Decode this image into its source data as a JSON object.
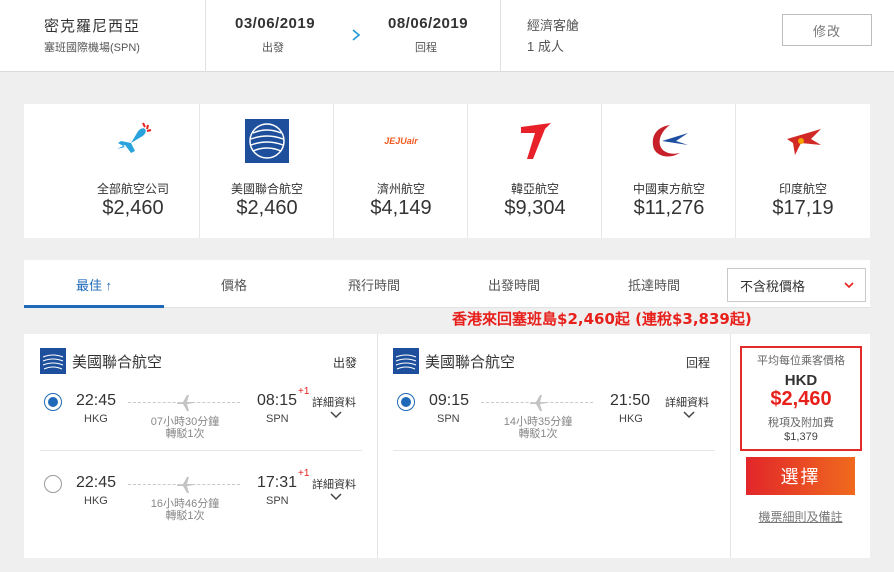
{
  "search": {
    "destination": "密克羅尼西亞",
    "airport": "塞班國際機場(SPN)",
    "depart_date": "03/06/2019",
    "depart_label": "出發",
    "return_date": "08/06/2019",
    "return_label": "回程",
    "cabin": "經濟客艙",
    "passengers": "1 成人",
    "modify_label": "修改"
  },
  "carousel": {
    "items": [
      {
        "name": "全部航空公司",
        "price": "$2,460",
        "icon": "plane-icon"
      },
      {
        "name": "美國聯合航空",
        "price": "$2,460",
        "icon": "united-logo"
      },
      {
        "name": "濟州航空",
        "price": "$4,149",
        "icon": "jejuair-logo",
        "logo_text": "JEJUair"
      },
      {
        "name": "韓亞航空",
        "price": "$9,304",
        "icon": "asiana-logo"
      },
      {
        "name": "中國東方航空",
        "price": "$11,276",
        "icon": "china-eastern-logo"
      },
      {
        "name": "印度航空",
        "price": "$17,19",
        "icon": "air-india-logo"
      }
    ]
  },
  "sort": {
    "tabs": [
      {
        "label": "最佳 ↑",
        "active": true
      },
      {
        "label": "價格",
        "active": false
      },
      {
        "label": "飛行時間",
        "active": false
      },
      {
        "label": "出發時間",
        "active": false
      },
      {
        "label": "抵達時間",
        "active": false
      }
    ],
    "tax_option": "不含稅價格"
  },
  "promo": "香港來回塞班島$2,460起 (連稅$3,839起)",
  "result": {
    "outbound": {
      "airline": "美國聯合航空",
      "direction": "出發",
      "options": [
        {
          "dep_time": "22:45",
          "dep_code": "HKG",
          "arr_time": "08:15",
          "plus": "+1",
          "arr_code": "SPN",
          "duration": "07小時30分鐘",
          "stops": "轉駁1次",
          "selected": true,
          "detail": "詳細資料"
        },
        {
          "dep_time": "22:45",
          "dep_code": "HKG",
          "arr_time": "17:31",
          "plus": "+1",
          "arr_code": "SPN",
          "duration": "16小時46分鐘",
          "stops": "轉駁1次",
          "selected": false,
          "detail": "詳細資料"
        }
      ]
    },
    "inbound": {
      "airline": "美國聯合航空",
      "direction": "回程",
      "options": [
        {
          "dep_time": "09:15",
          "dep_code": "SPN",
          "arr_time": "21:50",
          "plus": "",
          "arr_code": "HKG",
          "duration": "14小時35分鐘",
          "stops": "轉駁1次",
          "selected": true,
          "detail": "詳細資料"
        }
      ]
    },
    "price": {
      "label": "平均每位乘客價格",
      "currency": "HKD",
      "amount": "$2,460",
      "tax_label": "稅項及附加費",
      "tax_amount": "$1,379",
      "select_label": "選擇",
      "fare_rules": "機票細則及備註"
    }
  },
  "colors": {
    "accent_blue": "#1f6ab8",
    "promo_red": "#e8201b",
    "button_start": "#e2262a",
    "button_end": "#f06a1e"
  }
}
